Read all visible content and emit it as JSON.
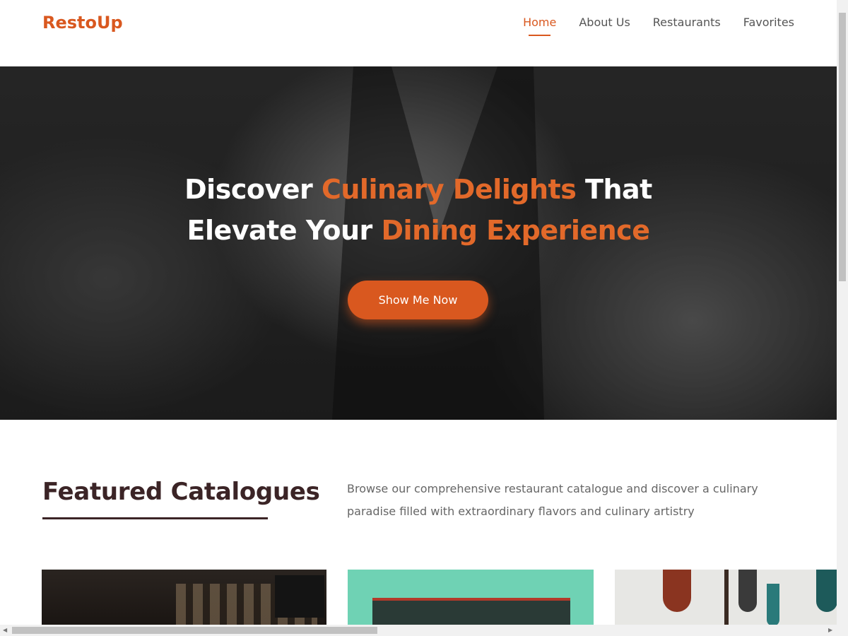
{
  "brand": "RestoUp",
  "nav": [
    {
      "label": "Home",
      "active": true
    },
    {
      "label": "About Us",
      "active": false
    },
    {
      "label": "Restaurants",
      "active": false
    },
    {
      "label": "Favorites",
      "active": false
    }
  ],
  "hero": {
    "line1_a": "Discover ",
    "line1_b": "Culinary Delights",
    "line1_c": " That",
    "line2_a": "Elevate Your ",
    "line2_b": "Dining Experience",
    "button": "Show Me Now"
  },
  "featured": {
    "title": "Featured Catalogues",
    "description": "Browse our comprehensive restaurant catalogue and discover a culinary paradise filled with extraordinary flavors and culinary artistry"
  },
  "colors": {
    "accent": "#d9581f",
    "heading": "#3b2426"
  }
}
